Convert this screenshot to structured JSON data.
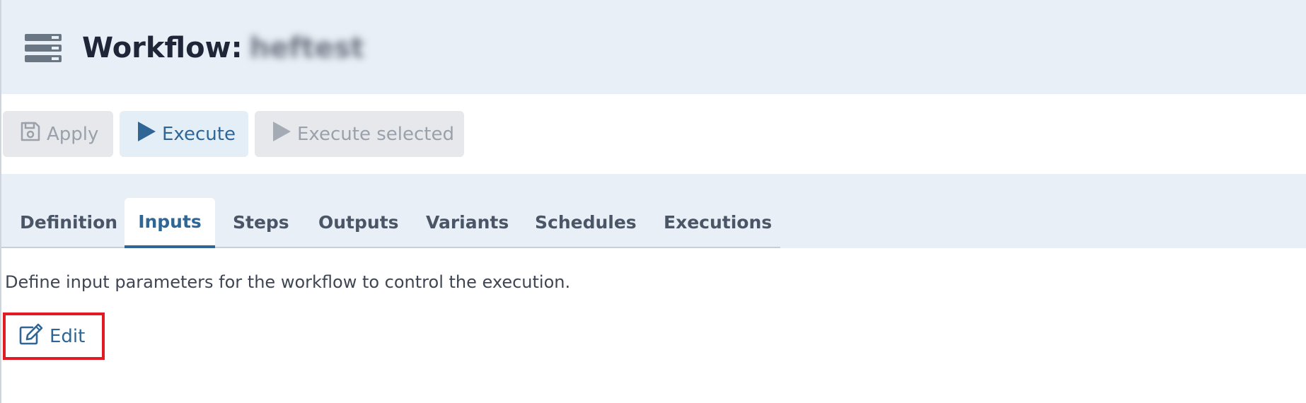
{
  "header": {
    "title_prefix": "Workflow:",
    "workflow_name": "heftest"
  },
  "toolbar": {
    "apply_label": "Apply",
    "execute_label": "Execute",
    "execute_selected_label": "Execute selected"
  },
  "tabs": [
    {
      "label": "Definition"
    },
    {
      "label": "Inputs",
      "active": true
    },
    {
      "label": "Steps"
    },
    {
      "label": "Outputs"
    },
    {
      "label": "Variants"
    },
    {
      "label": "Schedules"
    },
    {
      "label": "Executions"
    }
  ],
  "content": {
    "description": "Define input parameters for the workflow to control the execution.",
    "edit_label": "Edit"
  },
  "colors": {
    "accent": "#2f6696",
    "header_bg": "#e8eff6",
    "disabled_text": "#9aa1ab",
    "highlight_outline": "#e01b24"
  },
  "icons": {
    "header": "server-stack-icon",
    "apply": "save-icon",
    "execute": "play-icon",
    "execute_selected": "play-icon",
    "edit": "edit-icon"
  }
}
